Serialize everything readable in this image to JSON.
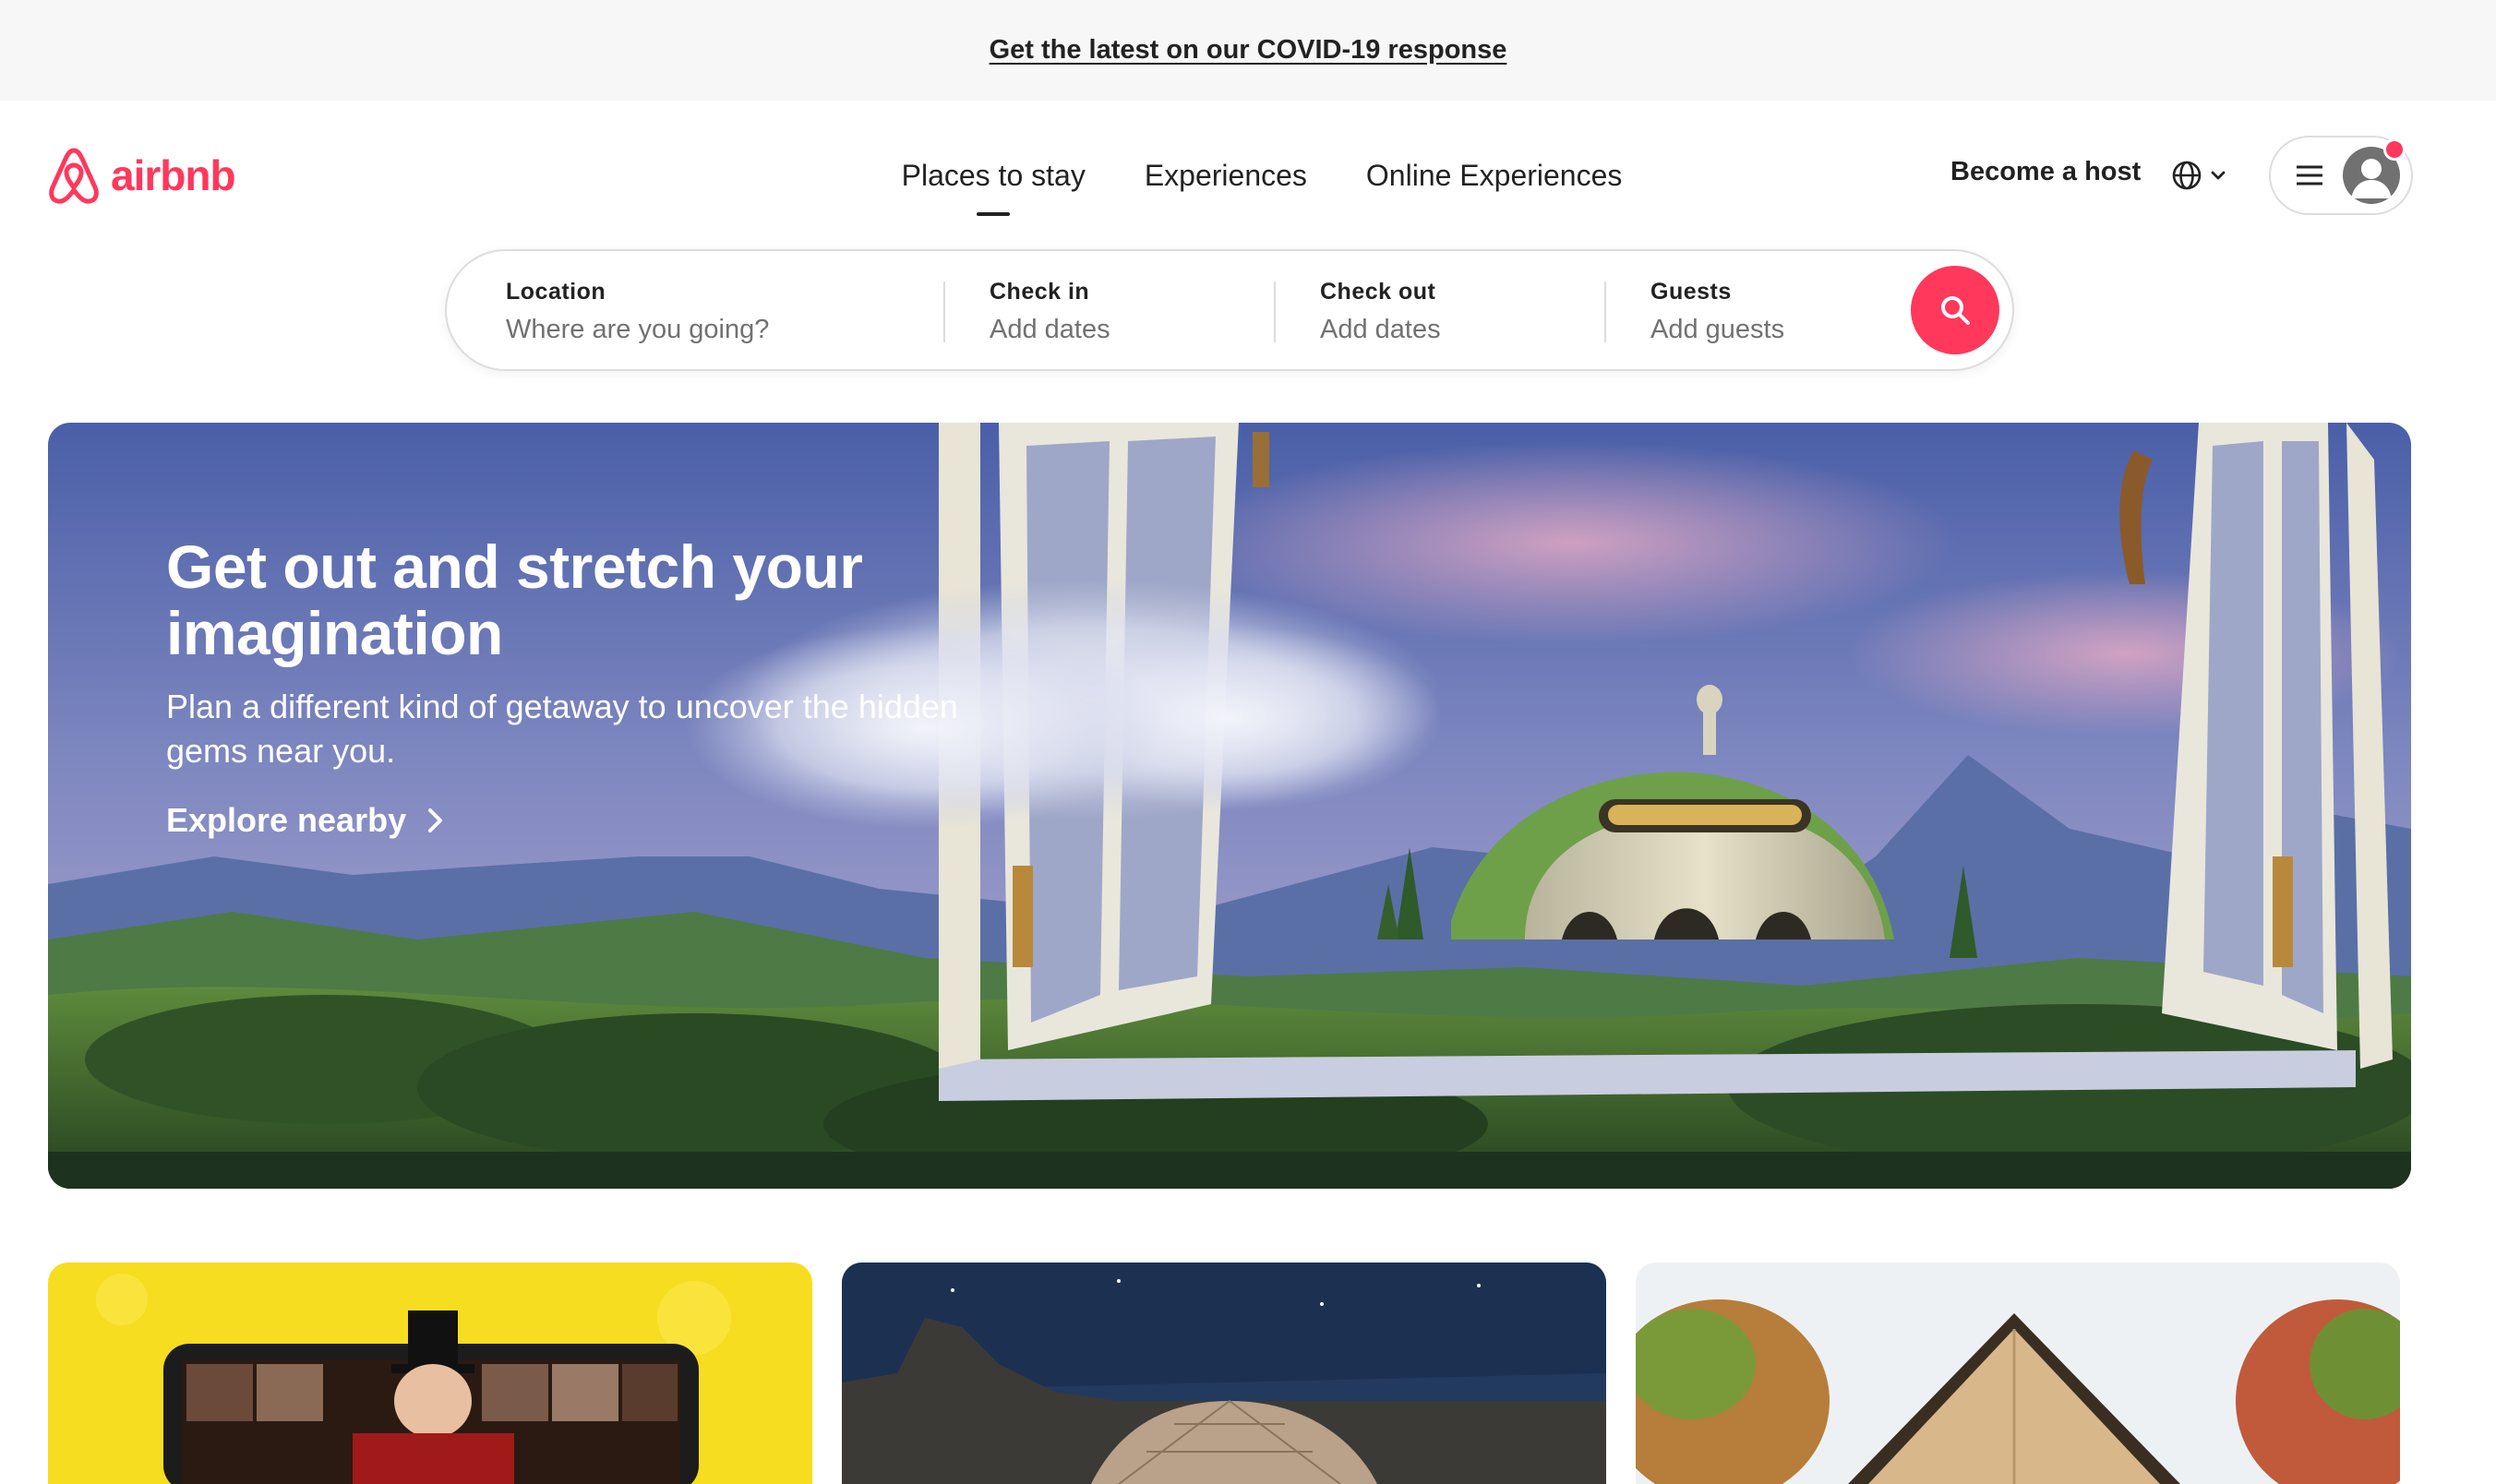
{
  "announcement": {
    "text": "Get the latest on our COVID-19 response"
  },
  "brand": {
    "name": "airbnb",
    "color": "#ff385c"
  },
  "nav": {
    "items": [
      {
        "label": "Places to stay",
        "active": true
      },
      {
        "label": "Experiences",
        "active": false
      },
      {
        "label": "Online Experiences",
        "active": false
      }
    ]
  },
  "header_right": {
    "host_label": "Become a host",
    "language_icon": "globe-icon",
    "menu_icon": "hamburger-menu-icon",
    "avatar_icon": "user-avatar-icon",
    "notification": true
  },
  "search": {
    "location": {
      "label": "Location",
      "placeholder": "Where are you going?"
    },
    "check_in": {
      "label": "Check in",
      "placeholder": "Add dates"
    },
    "check_out": {
      "label": "Check out",
      "placeholder": "Add dates"
    },
    "guests": {
      "label": "Guests",
      "placeholder": "Add guests"
    },
    "button_icon": "search-icon"
  },
  "hero": {
    "title": "Get out and stretch your imagination",
    "subtitle": "Plan a different kind of getaway to uncover the hidden gems near you.",
    "cta": "Explore nearby"
  },
  "cards": [
    {
      "image": "online-experience-video-call"
    },
    {
      "image": "geodesic-dome-night"
    },
    {
      "image": "a-frame-cabin"
    }
  ]
}
